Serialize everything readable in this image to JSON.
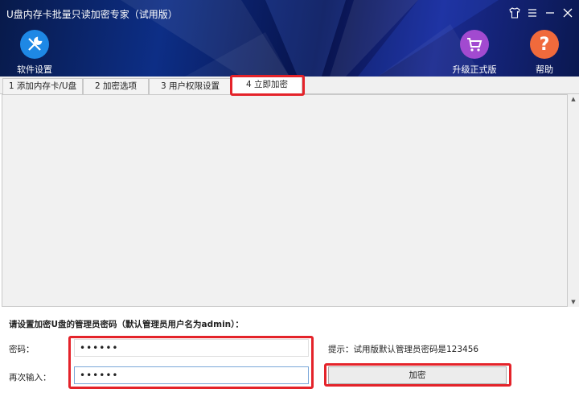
{
  "app": {
    "title": "U盘内存卡批量只读加密专家（试用版）"
  },
  "window_controls": {
    "skin_icon": "shirt-icon",
    "menu_icon": "menu-icon",
    "minimize_icon": "minimize-icon",
    "close_icon": "close-icon"
  },
  "toolbar": {
    "settings": {
      "label": "软件设置",
      "icon": "wrench-screwdriver-icon",
      "color": "#1e88e5"
    },
    "upgrade": {
      "label": "升级正式版",
      "icon": "cart-icon",
      "color": "#a24ad0"
    },
    "help": {
      "label": "帮助",
      "icon": "question-icon",
      "color": "#f06a3c"
    }
  },
  "tabs": [
    {
      "label": "1 添加内存卡/U盘",
      "active": false
    },
    {
      "label": "2 加密选项",
      "active": false
    },
    {
      "label": "3 用户权限设置",
      "active": false
    },
    {
      "label": "4 立即加密",
      "active": true
    }
  ],
  "form": {
    "instruction": "请设置加密U盘的管理员密码（默认管理员用户名为admin）：",
    "password_label": "密码：",
    "password_value": "••••••",
    "confirm_label": "再次输入：",
    "confirm_value": "••••••",
    "hint": "提示：试用版默认管理员密码是123456",
    "encrypt_button": "加密"
  },
  "colors": {
    "highlight": "#e4232a",
    "header_bg": "#0d2e86"
  }
}
